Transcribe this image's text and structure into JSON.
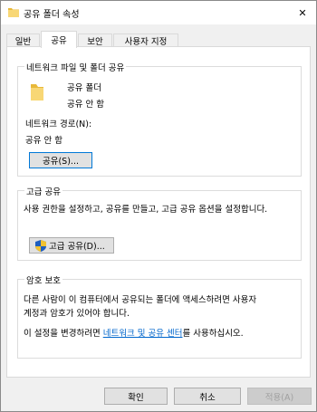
{
  "window": {
    "title": "공유 폴더 속성",
    "close_symbol": "✕"
  },
  "tabs": [
    {
      "label": "일반",
      "active": false
    },
    {
      "label": "공유",
      "active": true
    },
    {
      "label": "보안",
      "active": false
    },
    {
      "label": "사용자 지정",
      "active": false
    }
  ],
  "network_sharing": {
    "group_title": "네트워크 파일 및 폴더 공유",
    "folder_name": "공유 폴더",
    "folder_status": "공유 안 함",
    "path_label": "네트워크 경로(N):",
    "path_value": "공유 안 함",
    "share_button": "공유(S)..."
  },
  "advanced_sharing": {
    "group_title": "고급 공유",
    "description": "사용 권한을 설정하고, 공유를 만들고, 고급 공유 옵션을 설정합니다.",
    "button": "고급 공유(D)..."
  },
  "password_protection": {
    "group_title": "암호 보호",
    "description_line1": "다른 사람이 이 컴퓨터에서 공유되는 폴더에 액세스하려면 사용자",
    "description_line2": "계정과 암호가 있어야 합니다.",
    "change_prefix": "이 설정을 변경하려면 ",
    "change_link": "네트워크 및 공유 센터",
    "change_suffix": "를 사용하십시오."
  },
  "footer": {
    "ok": "확인",
    "cancel": "취소",
    "apply": "적용(A)"
  },
  "colors": {
    "accent": "#0078d7",
    "link": "#0066cc",
    "folder": "#f8d775"
  },
  "icons": {
    "title": "folder-icon",
    "folder": "folder-icon",
    "shield": "uac-shield-icon",
    "close": "close-icon"
  }
}
